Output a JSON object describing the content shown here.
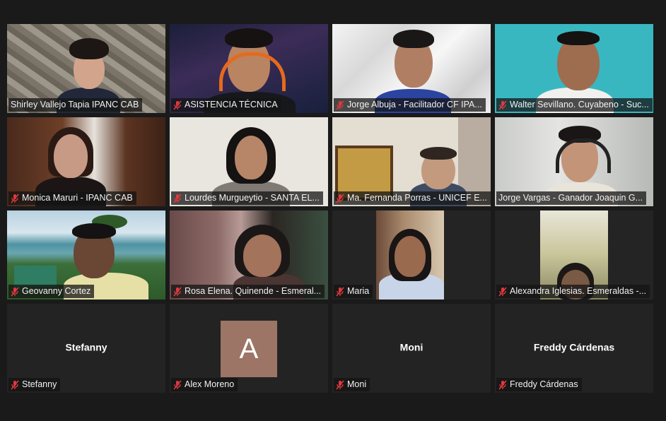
{
  "participants": [
    {
      "name": "Shirley Vallejo Tapia IPANC CAB",
      "muted": true
    },
    {
      "name": "ASISTENCIA TÉCNICA",
      "muted": true
    },
    {
      "name": "Jorge Albuja - Facilitador CF IPA...",
      "muted": true
    },
    {
      "name": "Walter Sevillano. Cuyabeno - Suc...",
      "muted": true
    },
    {
      "name": "Monica Maruri - IPANC CAB",
      "muted": true
    },
    {
      "name": "Lourdes Murgueytio - SANTA EL...",
      "muted": true
    },
    {
      "name": "Ma. Fernanda Porras - UNICEF E...",
      "muted": true
    },
    {
      "name": "Jorge Vargas - Ganador Joaquin G...",
      "muted": false,
      "active_speaker": true
    },
    {
      "name": "Geovanny Cortez",
      "muted": true
    },
    {
      "name": "Rosa Elena. Quinende - Esmeral...",
      "muted": true
    },
    {
      "name": "Maria",
      "muted": true
    },
    {
      "name": "Alexandra Iglesias. Esmeraldas -...",
      "muted": true
    },
    {
      "name": "Stefanny",
      "display": "Stefanny",
      "muted": true,
      "video_off": true
    },
    {
      "name": "Alex Moreno",
      "avatar_letter": "A",
      "muted": true,
      "video_off": true
    },
    {
      "name": "Moni",
      "display": "Moni",
      "muted": true,
      "video_off": true
    },
    {
      "name": "Freddy Cárdenas",
      "display": "Freddy Cárdenas",
      "muted": true,
      "video_off": true
    }
  ],
  "colors": {
    "background": "#1a1a1a",
    "tile": "#232323",
    "active_border": "#c9e33b",
    "muted_icon": "#e0393e",
    "avatar_bg": "#9c7566"
  },
  "icons": {
    "muted": "mic-muted-icon"
  }
}
